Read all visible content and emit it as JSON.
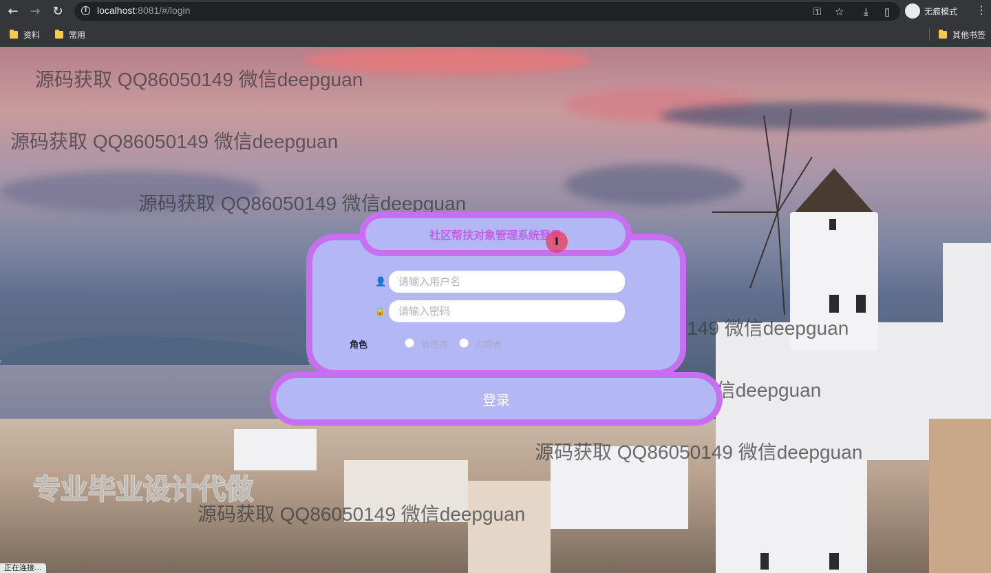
{
  "browser": {
    "url_host": "localhost",
    "url_rest": ":8081/#/login",
    "incognito_label": "无痕模式",
    "bookmarks": [
      "资料",
      "常用"
    ],
    "other_bookmarks": "其他书签"
  },
  "login": {
    "title": "社区帮扶对象管理系统登录",
    "username_placeholder": "请输入用户名",
    "password_placeholder": "请输入密码",
    "role_label": "角色",
    "role_options": [
      "管理员",
      "志愿者"
    ],
    "submit_label": "登录"
  },
  "watermarks": {
    "text": "源码获取 QQ86050149 微信deepguan",
    "banner": "专业毕业设计代做"
  },
  "status_text": "正在连接..."
}
